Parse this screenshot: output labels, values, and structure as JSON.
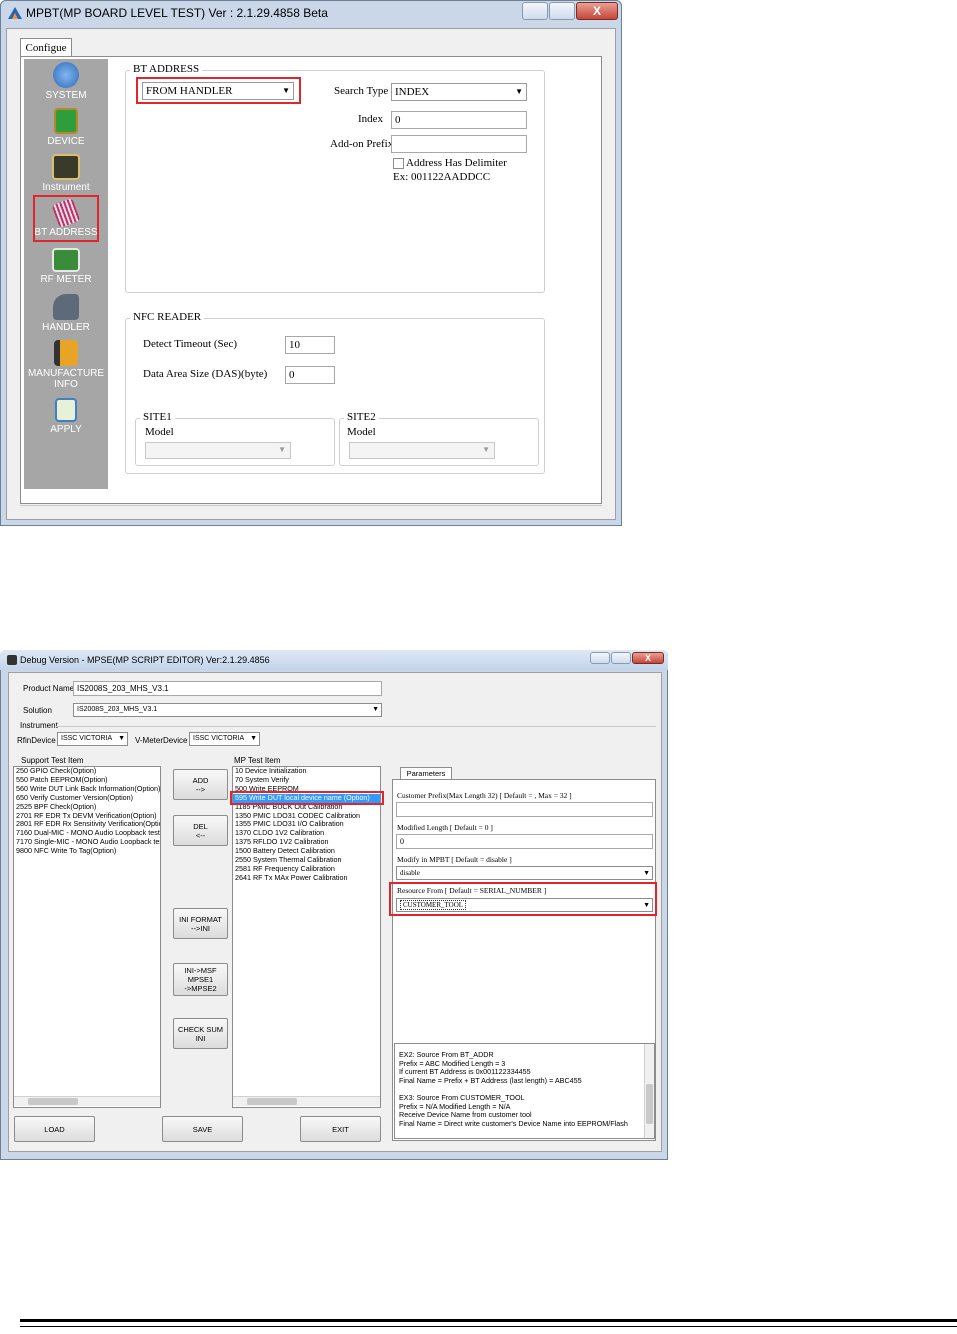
{
  "win1": {
    "title": "MPBT(MP BOARD LEVEL TEST) Ver : 2.1.29.4858 Beta",
    "close": "X",
    "tab": "Configue",
    "sidebar": [
      {
        "label": "SYSTEM",
        "icon": "gear-globe-icon"
      },
      {
        "label": "DEVICE",
        "icon": "chip-icon"
      },
      {
        "label": "Instrument",
        "icon": "oscilloscope-icon"
      },
      {
        "label": "BT ADDRESS",
        "icon": "barcode-icon",
        "selected": true
      },
      {
        "label": "RF METER",
        "icon": "monitor-icon"
      },
      {
        "label": "HANDLER",
        "icon": "robot-arm-icon"
      },
      {
        "label": "MANUFACTURE",
        "label2": "INFO",
        "icon": "factory-icon"
      },
      {
        "label": "APPLY",
        "icon": "clipboard-check-icon"
      }
    ],
    "bt_address": {
      "group_title": "BT ADDRESS",
      "source_value": "FROM HANDLER",
      "search_type_label": "Search Type",
      "search_type_value": "INDEX",
      "index_label": "Index",
      "index_value": "0",
      "prefix_label": "Add-on Prefix",
      "prefix_value": "",
      "delimiter_label": "Address Has Delimiter",
      "example": "Ex: 001122AADDCC"
    },
    "nfc": {
      "group_title": "NFC READER",
      "timeout_label": "Detect Timeout (Sec)",
      "timeout_value": "10",
      "das_label": "Data Area Size (DAS)(byte)",
      "das_value": "0",
      "site1_title": "SITE1",
      "site1_model": "Model",
      "site2_title": "SITE2",
      "site2_model": "Model"
    }
  },
  "win2": {
    "title": "Debug Version - MPSE(MP SCRIPT EDITOR) Ver:2.1.29.4856",
    "product_name_label": "Product Name",
    "product_name_value": "IS2008S_203_MHS_V3.1",
    "solution_label": "Solution",
    "solution_value": "IS2008S_203_MHS_V3.1",
    "instrument_label": "Instrument",
    "rf_device_label": "RfinDevice",
    "rf_device_value": "ISSC VICTORIA",
    "vmeter_label": "V-MeterDevice",
    "vmeter_value": "ISSC VICTORIA",
    "support_header": "Support Test Item",
    "support_items": [
      "250 GPIO Check(Option)",
      "550 Patch EEPROM(Option)",
      "560 Write DUT Link Back Information(Option)",
      "650 Verify Customer Version(Option)",
      "2525 BPF Check(Option)",
      "2701 RF EDR Tx DEVM Verification(Option)",
      "2801 RF EDR Rx Sensitivity Verification(Optio",
      "7160 Dual-MIC - MONO Audio Loopback test",
      "7170 Single-MIC - MONO Audio Loopback tes",
      "9800 NFC Write To Tag(Option)"
    ],
    "mp_header": "MP Test Item",
    "mp_items": [
      "10 Device Initialization",
      "70 System Verify",
      "500 Write EEPROM",
      "595 Write DUT local device name (Option)",
      "1185 PMIC BUCK Out Calibration",
      "1350 PMIC LDO31 CODEC Calibration",
      "1355 PMIC LDO31 I/O Calibration",
      "1370 CLDO 1V2 Calibration",
      "1375 RFLDO 1V2 Calibration",
      "1500 Battery Detect Calibration",
      "2550 System Thermal Calibration",
      "2581 RF Frequency Calibration",
      "2641 RF Tx MAx Power Calibration"
    ],
    "mp_selected_index": 3,
    "buttons": {
      "add": "ADD\n-->",
      "del": "DEL\n<--",
      "ini_format": "INI FORMAT\n-->INI",
      "ini_msf": "INI->MSF\nMPSE1\n->MPSE2",
      "checksum": "CHECK SUM INI",
      "load": "LOAD",
      "save": "SAVE",
      "exit": "EXIT"
    },
    "params": {
      "tab": "Parameters",
      "customer_prefix_label": "Customer Prefix(Max Length 32) [ Default = , Max = 32 ]",
      "customer_prefix_value": "",
      "modified_length_label": "Modified Length [ Default = 0 ]",
      "modified_length_value": "0",
      "modify_label": "Modify in MPBT [ Default = disable ]",
      "modify_value": "disable",
      "resource_label": "Resource From [ Default = SERIAL_NUMBER ]",
      "resource_value": "CUSTOMER_TOOL"
    },
    "notes": [
      "EX2: Source From BT_ADDR",
      "Prefix = ABC  Modified Length = 3",
      "If current BT Address is 0x001122334455",
      "Final Name = Prefix + BT Address (last length)  = ABC455",
      "",
      "EX3: Source From CUSTOMER_TOOL",
      "Prefix = N/A   Modified Length = N/A",
      "Receive Device Name from customer tool",
      "Final Name = Direct write customer's Device Name into EEPROM/Flash"
    ]
  }
}
